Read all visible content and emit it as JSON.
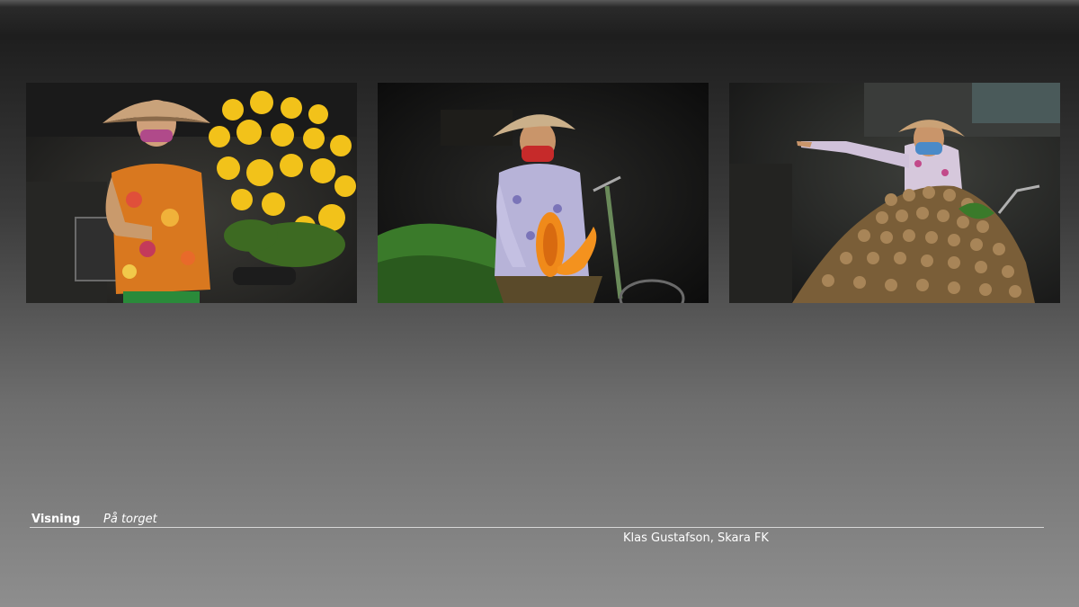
{
  "slide": {
    "title": "Visning",
    "subtitle": "På torget",
    "credit": "Klas Gustafson, Skara FK"
  },
  "photos": [
    {
      "subject": "woman-with-yellow-flowers"
    },
    {
      "subject": "woman-with-papaya-on-bicycle"
    },
    {
      "subject": "woman-pointing-with-longan-fruit"
    }
  ]
}
